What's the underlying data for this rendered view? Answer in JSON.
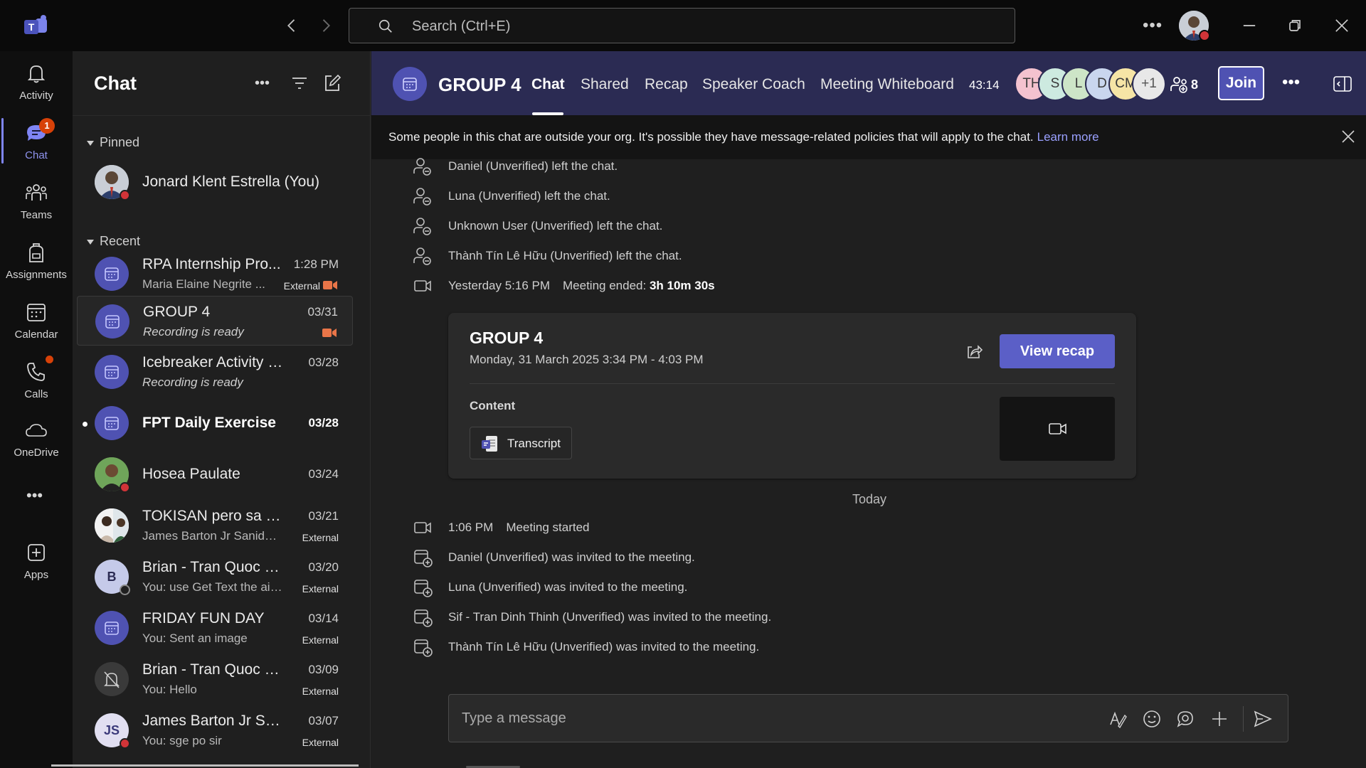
{
  "titlebar": {
    "search_placeholder": "Search (Ctrl+E)"
  },
  "rail": {
    "items": [
      {
        "label": "Activity",
        "icon": "bell-icon"
      },
      {
        "label": "Chat",
        "icon": "chat-icon",
        "badge": "1"
      },
      {
        "label": "Teams",
        "icon": "teams-icon"
      },
      {
        "label": "Assignments",
        "icon": "backpack-icon"
      },
      {
        "label": "Calendar",
        "icon": "calendar-icon"
      },
      {
        "label": "Calls",
        "icon": "phone-icon"
      },
      {
        "label": "OneDrive",
        "icon": "cloud-icon"
      },
      {
        "label": "Apps",
        "icon": "add-app-icon"
      }
    ]
  },
  "chatlist": {
    "title": "Chat",
    "pinned_label": "Pinned",
    "recent_label": "Recent",
    "pinned": [
      {
        "name": "Jonard Klent Estrella (You)"
      }
    ],
    "recent": [
      {
        "name": "RPA Internship Pro...",
        "sub": "Maria Elaine Negrite ...",
        "date": "1:28 PM",
        "tag": "External"
      },
      {
        "name": "GROUP 4",
        "sub": "Recording is ready",
        "date": "03/31"
      },
      {
        "name": "Icebreaker Activity fo...",
        "sub": "Recording is ready",
        "date": "03/28"
      },
      {
        "name": "FPT Daily Exercise",
        "sub": "",
        "date": "03/28"
      },
      {
        "name": "Hosea Paulate",
        "sub": "",
        "date": "03/24"
      },
      {
        "name": "TOKISAN pero sa MS...",
        "sub": "James Barton Jr Sanidad: ...",
        "date": "03/21",
        "tag": "External"
      },
      {
        "name": "Brian - Tran Quoc Bao",
        "sub": "You: use Get Text the aim...",
        "date": "03/20",
        "tag": "External",
        "initial": "B"
      },
      {
        "name": "FRIDAY FUN DAY",
        "sub": "You: Sent an image",
        "date": "03/14",
        "tag": "External"
      },
      {
        "name": "Brian - Tran Quoc Bao",
        "sub": "You: Hello",
        "date": "03/09",
        "tag": "External"
      },
      {
        "name": "James Barton Jr Sani...",
        "sub": "You: sge po sir",
        "date": "03/07",
        "tag": "External",
        "initial": "JS"
      }
    ]
  },
  "header": {
    "title": "GROUP 4",
    "tabs": [
      "Chat",
      "Shared",
      "Recap",
      "Speaker Coach",
      "Meeting Whiteboard"
    ],
    "timer": "43:14",
    "participants": [
      "TH",
      "S",
      "L",
      "D",
      "CM",
      "+1"
    ],
    "people_count": "8",
    "join_label": "Join"
  },
  "notice": {
    "text": "Some people in this chat are outside your org. It's possible they have message-related policies that will apply to the chat.",
    "link": "Learn more"
  },
  "events_top": [
    "Daniel (Unverified) left the chat.",
    "Luna (Unverified) left the chat.",
    "Unknown User (Unverified) left the chat.",
    "Thành Tín Lê Hữu (Unverified) left the chat."
  ],
  "meeting_ended": {
    "time": "Yesterday 5:16 PM",
    "text": "Meeting ended:",
    "duration": "3h 10m 30s"
  },
  "card": {
    "title": "GROUP 4",
    "subtitle": "Monday, 31 March 2025 3:34 PM - 4:03 PM",
    "button": "View recap",
    "content_label": "Content",
    "transcript_label": "Transcript"
  },
  "divider_today": "Today",
  "meeting_started": {
    "time": "1:06 PM",
    "text": "Meeting started"
  },
  "events_bottom": [
    "Daniel (Unverified) was invited to the meeting.",
    "Luna (Unverified) was invited to the meeting.",
    "Sif - Tran Dinh Thinh (Unverified) was invited to the meeting.",
    "Thành Tín Lê Hữu (Unverified) was invited to the meeting."
  ],
  "composer": {
    "placeholder": "Type a message"
  },
  "colors": {
    "accent": "#5b5fc7",
    "header_bg": "#2b2b53",
    "badge": "#d74108",
    "presence_busy": "#d13438"
  }
}
